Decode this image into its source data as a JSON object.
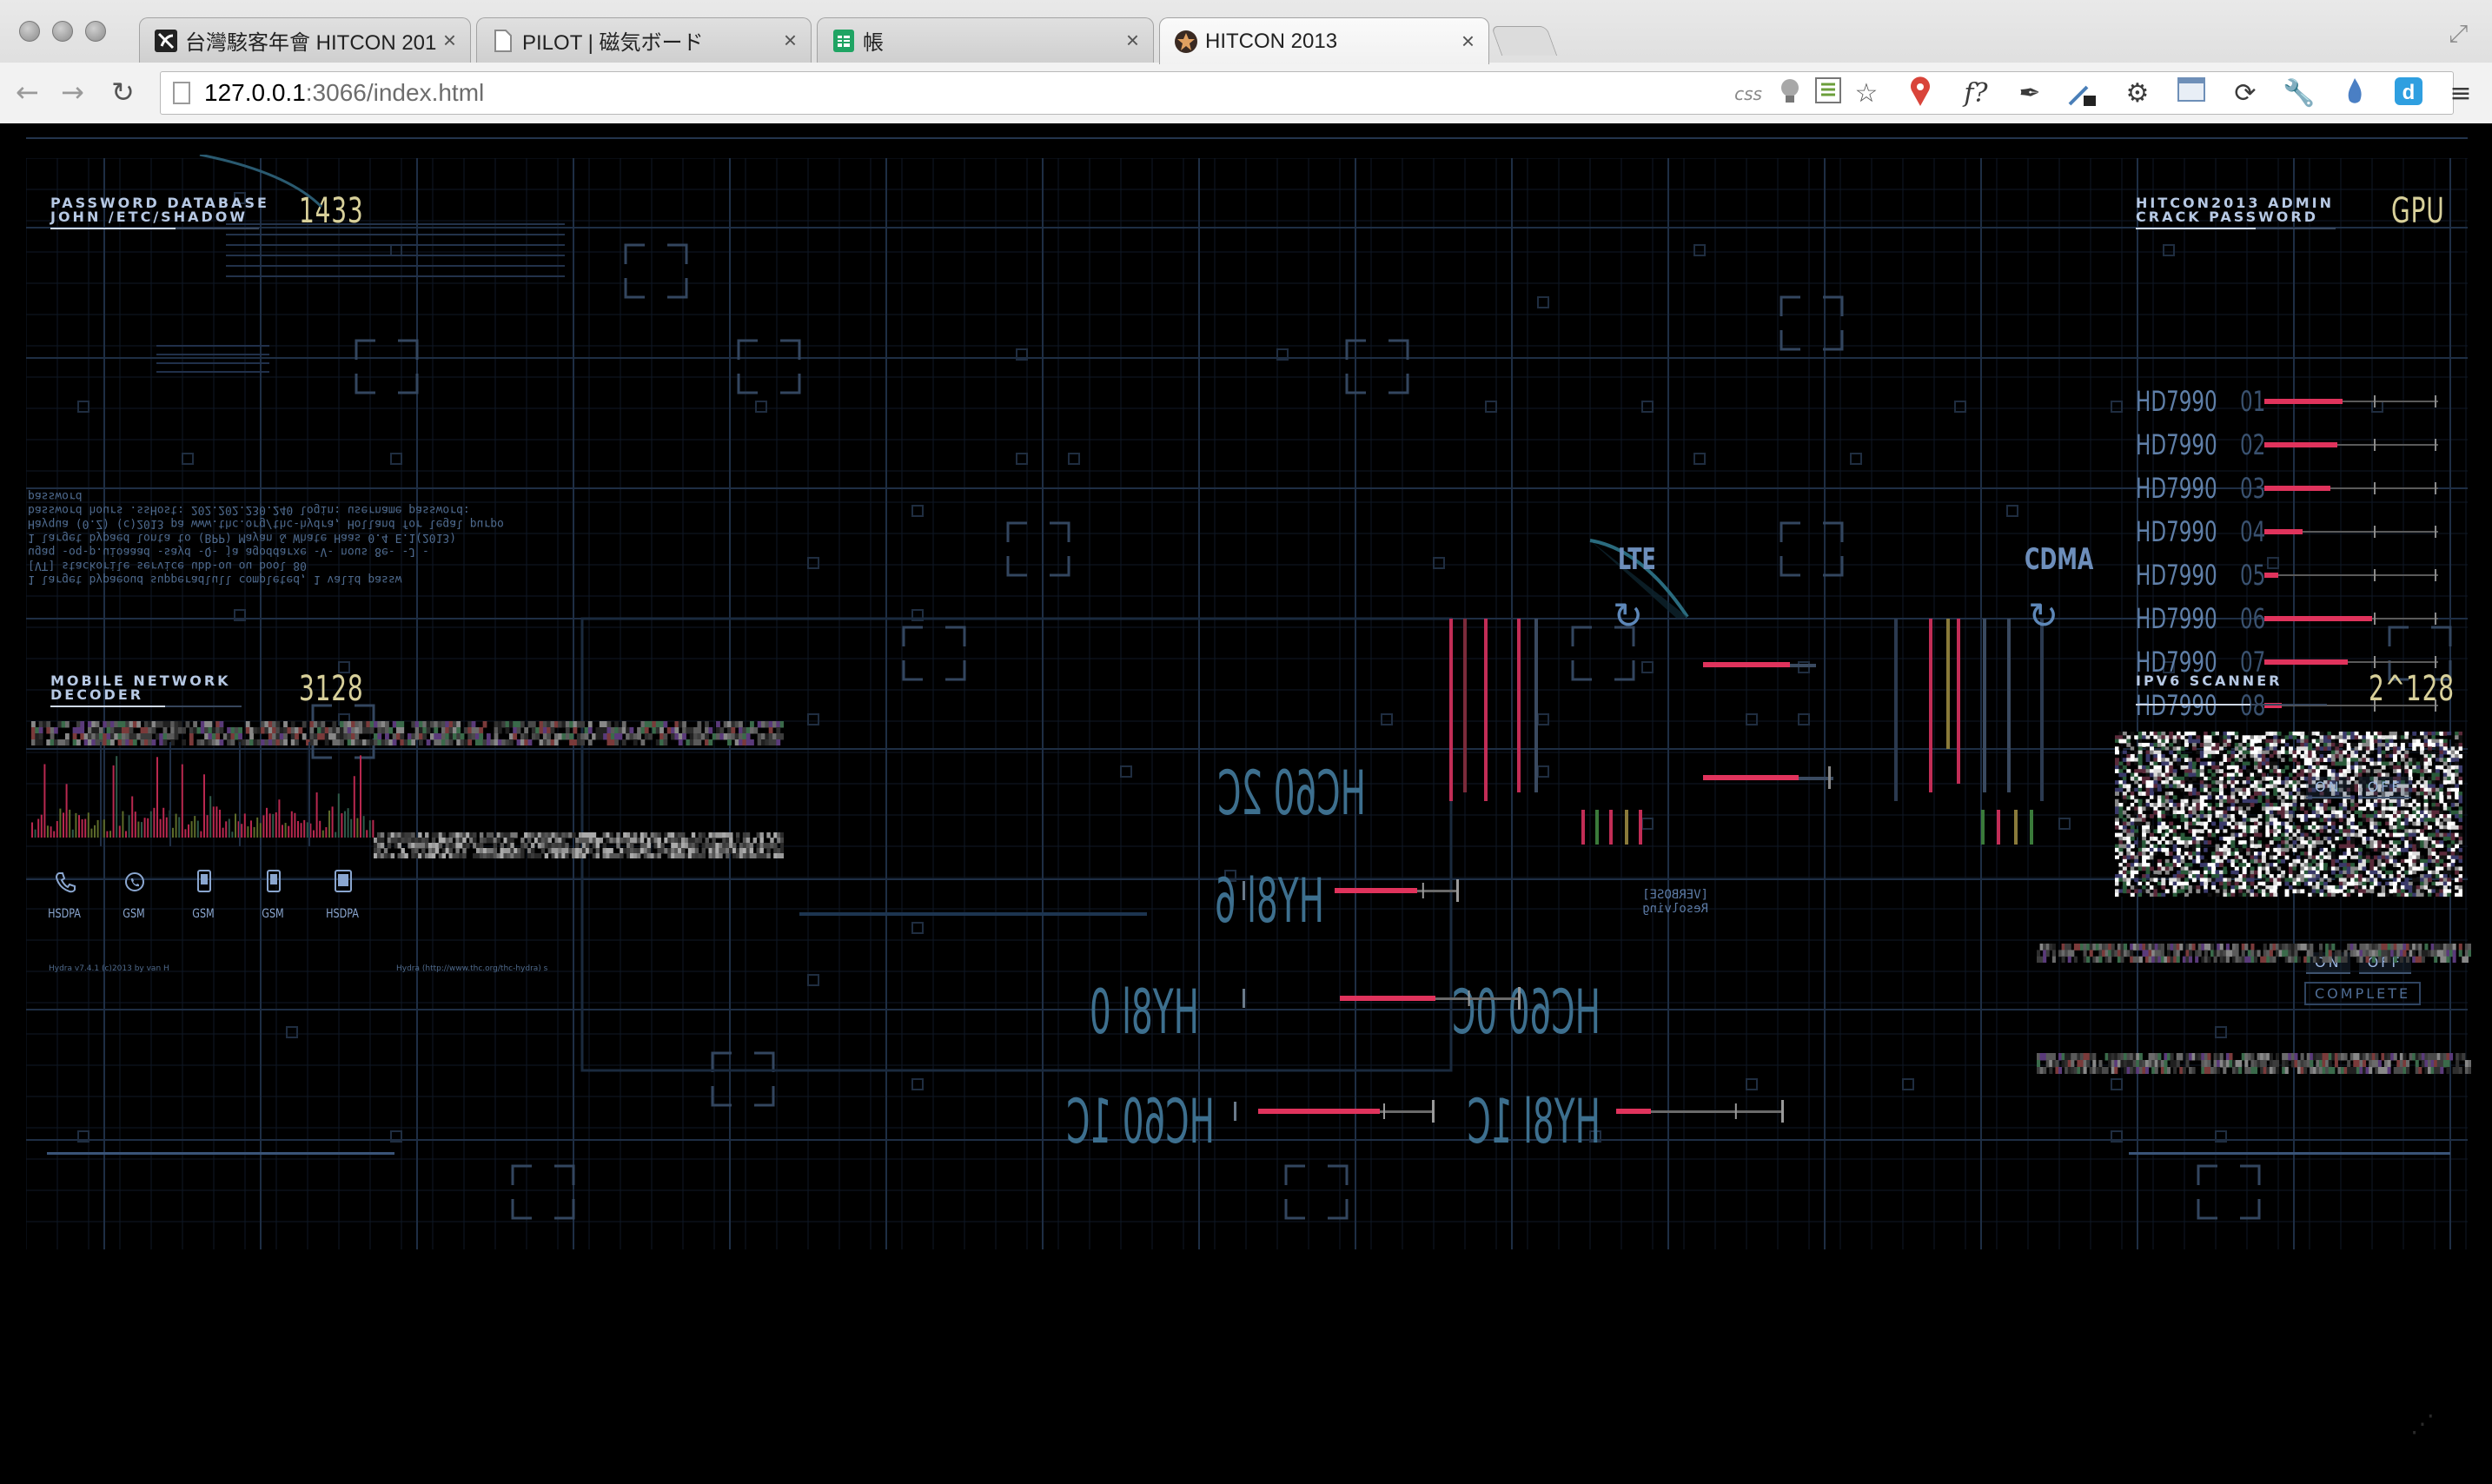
{
  "browser": {
    "tabs": [
      {
        "label": "台灣駭客年會 HITCON 2013",
        "favicon": "hitcon-logo-icon",
        "active": false
      },
      {
        "label": "PILOT | 磁気ボード",
        "favicon": "page-icon",
        "active": false
      },
      {
        "label": "帳",
        "favicon": "sheets-icon",
        "active": false
      },
      {
        "label": "HITCON 2013",
        "favicon": "hitcon-star-icon",
        "active": true
      }
    ],
    "tab_close": "×",
    "url_host": "127.0.0.1",
    "url_rest": ":3066/index.html",
    "extensions": [
      "css-icon",
      "lightbulb-icon",
      "list-icon",
      "star-icon",
      "map-pin-icon",
      "function-icon",
      "pen-icon",
      "eyedropper-icon",
      "gear-icon",
      "window-icon",
      "sync-icon",
      "wrench-icon",
      "flame-icon",
      "d-icon",
      "menu-icon"
    ],
    "ext_css_label": "css",
    "ext_f_label": "f?"
  },
  "hud": {
    "password_panel": {
      "title_line1": "PASSWORD DATABASE",
      "title_line2": "JOHN /ETC/SHADOW",
      "value": "1433"
    },
    "mobile_panel": {
      "title_line1": "MOBILE NETWORK",
      "title_line2": "DECODER",
      "value": "3128"
    },
    "admin_panel": {
      "title_line1": "HITCON2013 ADMIN",
      "title_line2": "CRACK PASSWORD",
      "value": "GPU"
    },
    "ipv6_panel": {
      "title": "IPV6 SCANNER",
      "value": "2^128"
    },
    "gpus": [
      {
        "name": "HD7990",
        "id": "01",
        "fill": 0.45
      },
      {
        "name": "HD7990",
        "id": "02",
        "fill": 0.42
      },
      {
        "name": "HD7990",
        "id": "03",
        "fill": 0.38
      },
      {
        "name": "HD7990",
        "id": "04",
        "fill": 0.22
      },
      {
        "name": "HD7990",
        "id": "05",
        "fill": 0.08
      },
      {
        "name": "HD7990",
        "id": "06",
        "fill": 0.62
      },
      {
        "name": "HD7990",
        "id": "07",
        "fill": 0.48
      },
      {
        "name": "HD7990",
        "id": "08",
        "fill": 0.1
      }
    ],
    "radio_icons": [
      {
        "icon": "phone-icon",
        "label": "HSDPA"
      },
      {
        "icon": "whatsapp-icon",
        "label": "GSM"
      },
      {
        "icon": "mobile-icon",
        "label": "GSM"
      },
      {
        "icon": "mobile-icon",
        "label": "GSM"
      },
      {
        "icon": "tablet-icon",
        "label": "HSDPA"
      }
    ],
    "terminal_lines": [
      "1 larget bypaeoud supperadlull completed, 1 valid passw",
      "[VT] stackorile service ubb-ou ou bool 80",
      "ugaq -oq-p.uioaaad -sayd -Q- ja agoddarxe -V- nous 8e- -J -",
      "1 larget bypaed lonta to (BPP) Mayan & Whate Haas 0.4 E.1(2013)",
      "Hayqua (0.Z) (c)2013 pa www.thc.org/thc-hydra, Holland for legal purpo",
      "bassword hours .ssHost: 202.202.230.240 login: username password: password"
    ],
    "footnote_left": "Hydra v7.4.1 (c)2013 by van H",
    "footnote_right": "Hydra (http://www.thc.org/thc-hydra) s",
    "lte_label": "LTE",
    "cdma_label": "CDMA",
    "verbose_text": "[VERBOSE] Resolving",
    "codes": [
      "HC60 2C",
      "HY8l 6",
      "HY8l 0",
      "HC60 0C",
      "HC60 1C",
      "HY8l 1C"
    ],
    "toggle_on": "ON",
    "toggle_off": "OFF",
    "complete_label": "COMPLETE",
    "accent_red": "#e0335c",
    "grid_color": "#1e2e44"
  }
}
